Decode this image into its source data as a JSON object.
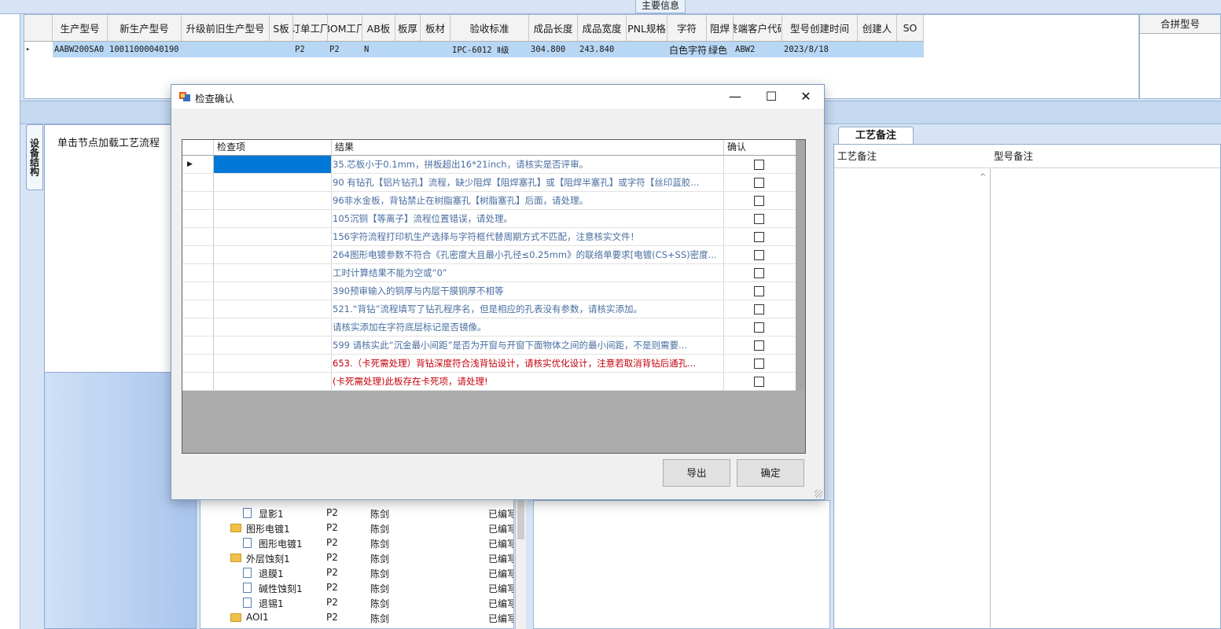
{
  "main_tab": "主要信息",
  "main_grid": {
    "columns": [
      "生产型号",
      "新生产型号",
      "升级前旧生产型号",
      "S板",
      "订单工厂",
      "BOM工厂",
      "AB板",
      "板厚",
      "板材",
      "验收标准",
      "成品长度",
      "成品宽度",
      "PNL规格",
      "字符",
      "阻焊",
      "终端客户代码",
      "型号创建时间",
      "创建人",
      "SO"
    ],
    "row": [
      "AABW200SA0",
      "10011000040190",
      "",
      "",
      "P2",
      "P2",
      "N",
      "",
      "",
      "IPC-6012 Ⅱ级",
      "304.800",
      "243.840",
      "",
      "白色字符",
      "绿色",
      "ABW2",
      "2023/8/18",
      "",
      ""
    ],
    "row_marker": "▸"
  },
  "merge_panel": {
    "header": "合拼型号"
  },
  "left_tab": "设备结构",
  "left_panel": {
    "title": "单击节点加载工艺流程"
  },
  "tree": [
    {
      "label": "显影1",
      "factory": "P2",
      "owner": "陈剑",
      "status": "已编写"
    },
    {
      "label": "图形电镀1",
      "factory": "P2",
      "owner": "陈剑",
      "status": "已编写"
    },
    {
      "label": "图形电镀1",
      "factory": "P2",
      "owner": "陈剑",
      "status": "已编写"
    },
    {
      "label": "外层蚀刻1",
      "factory": "P2",
      "owner": "陈剑",
      "status": "已编写"
    },
    {
      "label": "退膜1",
      "factory": "P2",
      "owner": "陈剑",
      "status": "已编写"
    },
    {
      "label": "碱性蚀刻1",
      "factory": "P2",
      "owner": "陈剑",
      "status": "已编写"
    },
    {
      "label": "退锡1",
      "factory": "P2",
      "owner": "陈剑",
      "status": "已编写"
    },
    {
      "label": "AOI1",
      "factory": "P2",
      "owner": "陈剑",
      "status": "已编写"
    }
  ],
  "right_panel": {
    "tab": "工艺备注",
    "col1": "工艺备注",
    "col2": "型号备注"
  },
  "dialog": {
    "title": "检查确认",
    "minimize": "—",
    "maximize": "☐",
    "close": "✕",
    "headers": {
      "item": "检查项",
      "result": "结果",
      "confirm": "确认"
    },
    "rows": [
      {
        "result": "35.芯板小于0.1mm，拼板超出16*21inch，请核实是否评审。",
        "red": false
      },
      {
        "result": "90 有钻孔【铝片钻孔】流程，缺少阻焊【阻焊塞孔】或【阻焊半塞孔】或字符【丝印蓝胶...",
        "red": false
      },
      {
        "result": "96非水金板，背钻禁止在树脂塞孔【树脂塞孔】后面，请处理。",
        "red": false
      },
      {
        "result": "105沉铜【等离子】流程位置错误，请处理。",
        "red": false
      },
      {
        "result": "156字符流程打印机生产选择与字符框代替周期方式不匹配，注意核实文件！",
        "red": false
      },
      {
        "result": "264图形电镀参数不符合《孔密度大且最小孔径≤0.25mm》的联络单要求[电镀(CS+SS)密度...",
        "red": false
      },
      {
        "result": "工时计算结果不能为空或“0”",
        "red": false
      },
      {
        "result": "390预审输入的铜厚与内层干膜铜厚不相等",
        "red": false
      },
      {
        "result": "521.“背钻”流程填写了钻孔程序名，但是相应的孔表没有参数，请核实添加。",
        "red": false
      },
      {
        "result": "请核实添加在字符底层标记是否镜像。",
        "red": false
      },
      {
        "result": "599 请核实此“沉金最小间距”是否为开窗与开窗下面物体之间的最小间距，不是则需要...",
        "red": false
      },
      {
        "result": "653.（卡死需处理）背钻深度符合浅背钻设计，请核实优化设计，注意若取消背钻后通孔...",
        "red": true
      },
      {
        "result": "(卡死需处理)此板存在卡死项，请处理!",
        "red": true
      }
    ],
    "export_button": "导出",
    "ok_button": "确定"
  }
}
